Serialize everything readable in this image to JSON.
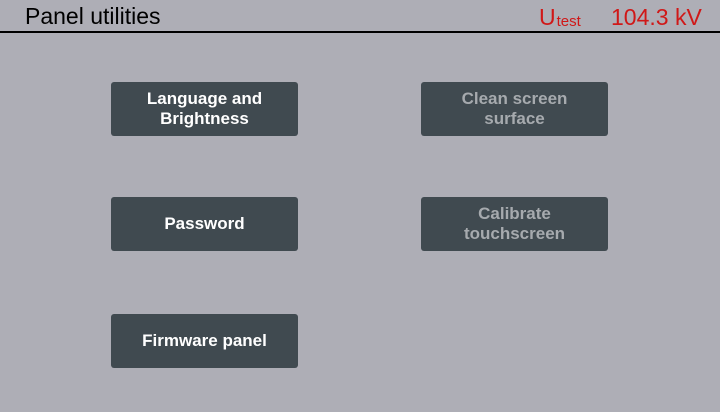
{
  "header": {
    "title": "Panel utilities",
    "utest_symbol": "U",
    "utest_subscript": "test",
    "utest_value": "104.3 kV"
  },
  "buttons": {
    "language_brightness": "Language and\nBrightness",
    "clean_screen": "Clean screen\nsurface",
    "password": "Password",
    "calibrate": "Calibrate\ntouchscreen",
    "firmware_panel": "Firmware panel"
  },
  "colors": {
    "background": "#aeaeb6",
    "button": "#404a50",
    "button_text": "#ffffff",
    "button_text_disabled": "#a6aaae",
    "utest": "#d01818"
  }
}
